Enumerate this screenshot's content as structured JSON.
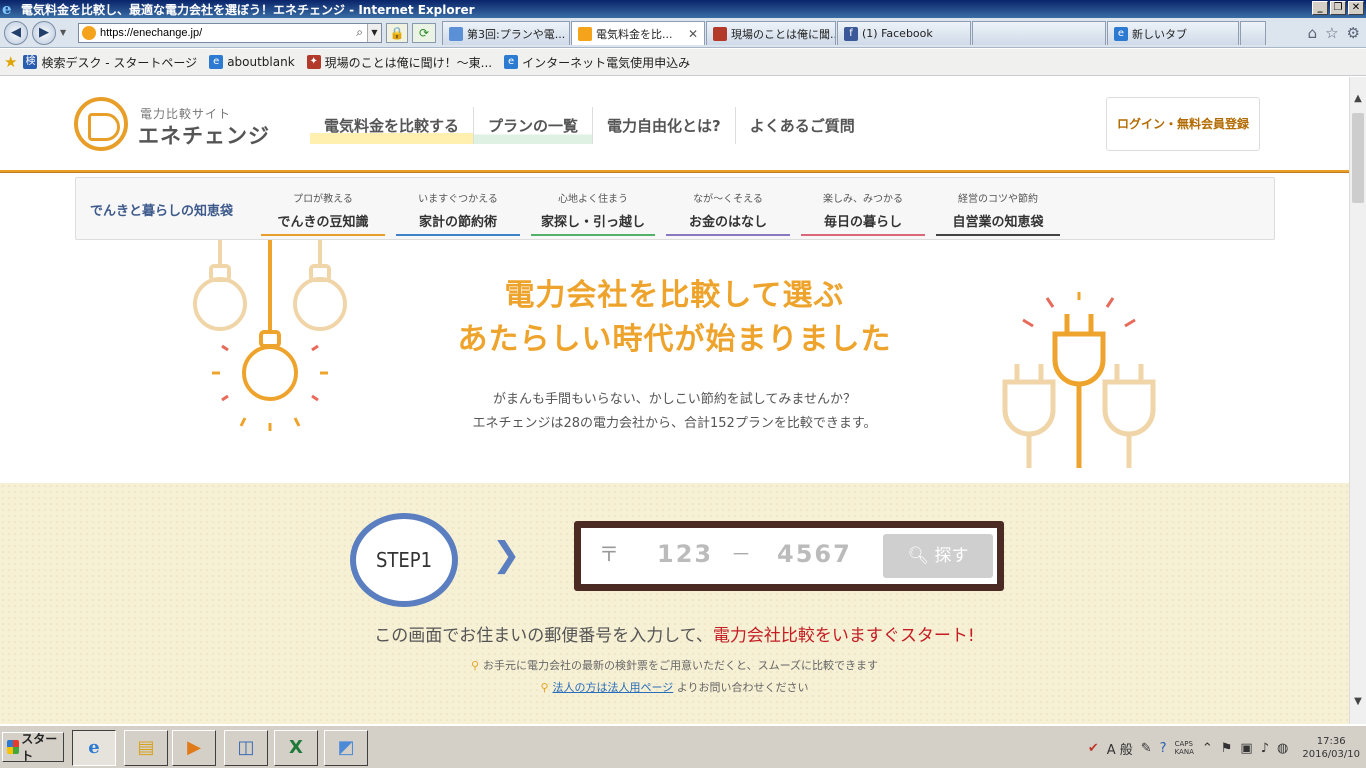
{
  "window": {
    "title": "電気料金を比較し、最適な電力会社を選ぼう！エネチェンジ - Internet Explorer",
    "controls": [
      "_",
      "❐",
      "✕"
    ]
  },
  "browser": {
    "address": "https://enechange.jp/",
    "tabs": [
      {
        "label": "第3回:プランや電...",
        "icon_color": "#5b8fd6"
      },
      {
        "label": "電気料金を比...",
        "icon_color": "#f5a31a",
        "active": true
      },
      {
        "label": "現場のことは俺に聞...",
        "icon_color": "#b33a2a"
      },
      {
        "label": "(1) Facebook",
        "icon_color": "#3b5998"
      },
      {
        "label": "",
        "icon_color": "#999999"
      },
      {
        "label": "新しいタブ",
        "icon_color": "#2c7ad2"
      }
    ],
    "favorites": [
      {
        "label": "検索デスク - スタートページ",
        "icon": "検",
        "icon_color": "#2a5db0"
      },
      {
        "label": "aboutblank",
        "icon": "e",
        "icon_color": "#2c7ad2"
      },
      {
        "label": "現場のことは俺に聞け！～東...",
        "icon": "✦",
        "icon_color": "#b33a2a"
      },
      {
        "label": "インターネット電気使用申込み",
        "icon": "e",
        "icon_color": "#2c7ad2"
      }
    ]
  },
  "site": {
    "logo_sub": "電力比較サイト",
    "logo_name": "エネチェンジ",
    "nav": [
      "電気料金を比較する",
      "プランの一覧",
      "電力自由化とは?",
      "よくあるご質問"
    ],
    "login": "ログイン・無料会員登録",
    "subnav_title": "でんきと暮らしの知恵袋",
    "subnav": [
      {
        "small": "プロが教える",
        "big": "でんきの豆知識",
        "color": "#e89f2a"
      },
      {
        "small": "いますぐつかえる",
        "big": "家計の節約術",
        "color": "#3d84c6"
      },
      {
        "small": "心地よく住まう",
        "big": "家探し・引っ越し",
        "color": "#54b16a"
      },
      {
        "small": "なが～くそえる",
        "big": "お金のはなし",
        "color": "#8a78c0"
      },
      {
        "small": "楽しみ、みつかる",
        "big": "毎日の暮らし",
        "color": "#d9687b"
      },
      {
        "small": "経営のコツや節約",
        "big": "自営業の知恵袋",
        "color": "#444444"
      }
    ],
    "hero": {
      "line1": "電力会社を比較して選ぶ",
      "line2": "あたらしい時代が始まりました",
      "desc1": "がまんも手間もいらない、かしこい節約を試してみませんか？",
      "desc2": "エネチェンジは28の電力会社から、合計152プランを比較できます。"
    },
    "search": {
      "step": "STEP1",
      "postal_mark": "〒",
      "zip1_placeholder": "123",
      "dash": "－",
      "zip2_placeholder": "4567",
      "button": "探す",
      "message_pre": "この画面でお住まいの郵便番号を入力して、",
      "message_red": "電力会社比較をいますぐスタート!",
      "note1": "お手元に電力会社の最新の検針票をご用意いただくと、スムーズに比較できます",
      "note2_link": "法人の方は法人用ページ",
      "note2_rest": "よりお問い合わせください"
    }
  },
  "taskbar": {
    "start": "スタート",
    "ime": "A 般",
    "caps": "CAPS",
    "kana": "KANA",
    "time": "17:36",
    "date": "2016/03/10"
  }
}
